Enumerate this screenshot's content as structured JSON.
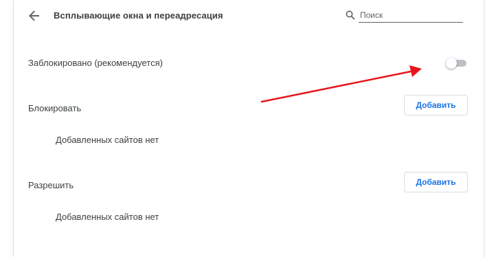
{
  "header": {
    "title": "Всплывающие окна и переадресация",
    "back_icon": "arrow-back-icon",
    "search": {
      "placeholder": "Поиск",
      "value": "",
      "icon": "search-icon"
    }
  },
  "blocked_setting": {
    "label": "Заблокировано (рекомендуется)",
    "toggle_on": false
  },
  "block_section": {
    "title": "Блокировать",
    "add_label": "Добавить",
    "empty_text": "Добавленных сайтов нет"
  },
  "allow_section": {
    "title": "Разрешить",
    "add_label": "Добавить",
    "empty_text": "Добавленных сайтов нет"
  },
  "colors": {
    "accent": "#1a73e8",
    "annotation_arrow": "#e8141b",
    "toggle_off_track": "#bdc1c6"
  }
}
